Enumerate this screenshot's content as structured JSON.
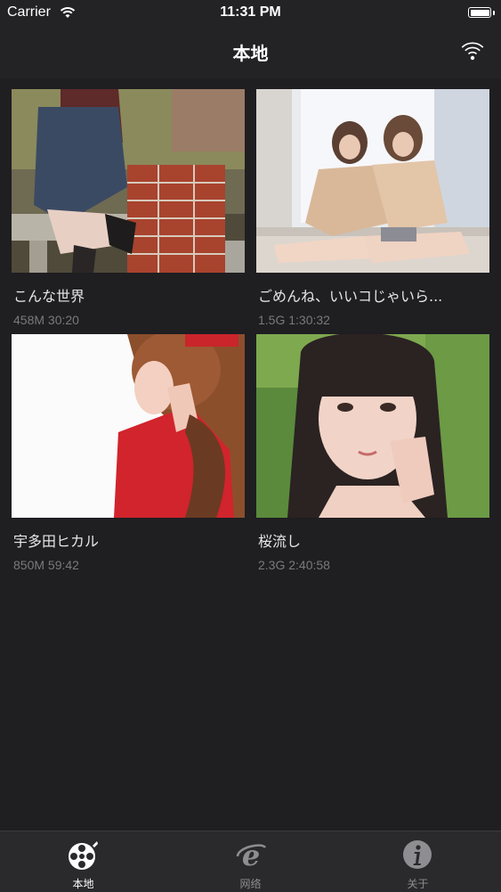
{
  "status_bar": {
    "carrier": "Carrier",
    "time": "11:31 PM"
  },
  "nav": {
    "title": "本地"
  },
  "videos": [
    {
      "title": "こんな世界",
      "size": "458M",
      "duration": "30:20"
    },
    {
      "title": "ごめんね、いいコじゃいら...",
      "size": "1.5G",
      "duration": "1:30:32"
    },
    {
      "title": "宇多田ヒカル",
      "size": "850M",
      "duration": "59:42"
    },
    {
      "title": "桜流し",
      "size": "2.3G",
      "duration": "2:40:58"
    }
  ],
  "tabs": [
    {
      "label": "本地",
      "icon": "film-reel-icon",
      "active": true
    },
    {
      "label": "网络",
      "icon": "internet-explorer-icon",
      "active": false
    },
    {
      "label": "关于",
      "icon": "info-icon",
      "active": false
    }
  ],
  "colors": {
    "background": "#1f1e21",
    "bar": "#232225",
    "tab_bar": "#2a292c",
    "meta_text": "#7a797d",
    "tab_inactive": "#8e8d91"
  }
}
